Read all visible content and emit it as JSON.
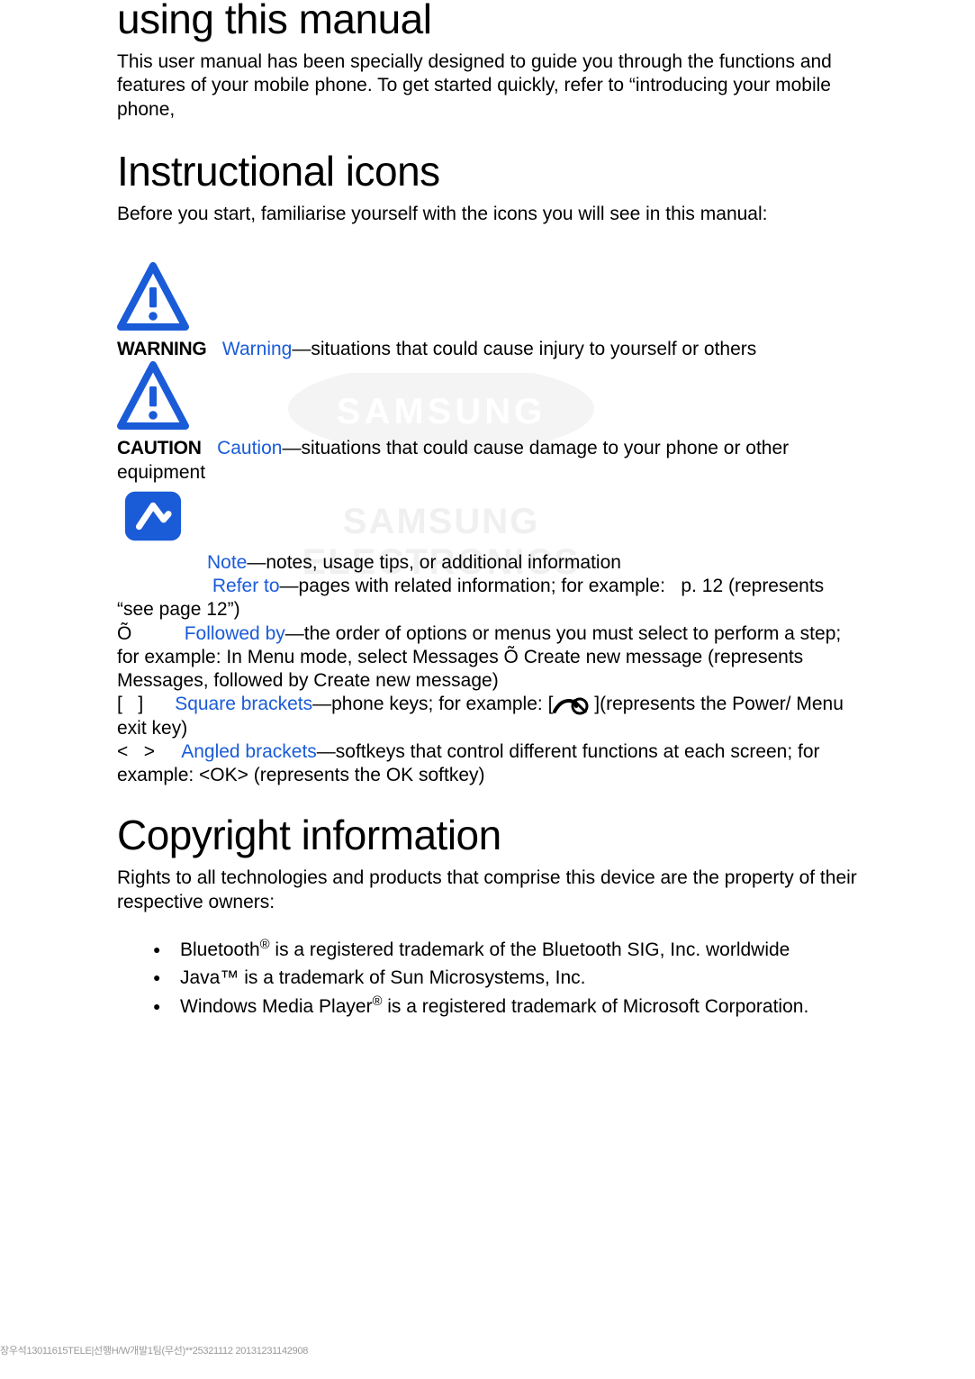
{
  "section1": {
    "title": "using this manual",
    "intro": "This user manual has been specially designed to guide you through the functions and features of your mobile phone. To get started quickly, refer to “introducing your mobile phone,"
  },
  "section2": {
    "title": "Instructional icons",
    "intro": "Before you start, familiarise yourself with the icons you will see in this manual:",
    "warning_label": "WARNING",
    "warning_term": "Warning",
    "warning_desc": "—situations that could cause injury to yourself or others",
    "caution_label": "CAUTION",
    "caution_term": "Caution",
    "caution_desc_1": "—situations that could cause damage to your phone or other equipment",
    "note_term": "Note",
    "note_desc": "—notes, usage tips, or additional information",
    "refer_term": "Refer to",
    "refer_desc_1": "—pages with related information; for example:   p. 12 (represents “see page 12”)",
    "followed_prefix": "Õ          ",
    "followed_term": "Followed by",
    "followed_desc": "—the order of options or menus you must select to perform a step; for example: In Menu mode, select Messages Õ Create new message (represents Messages, followed by Create new message)",
    "square_prefix": "[   ]      ",
    "square_term": "Square brackets",
    "square_desc_1": "—phone keys; for example: [",
    "square_desc_2": " ](represents the Power/ Menu exit key)",
    "angled_prefix": "<   >     ",
    "angled_term": "Angled brackets",
    "angled_desc": "—softkeys that control different functions at each screen; for example: <OK> (represents the OK softkey)"
  },
  "section3": {
    "title": "Copyright information",
    "intro": "Rights to all technologies and products that comprise this device are the property of their respective owners:",
    "items_html": [
      "Bluetooth<sup>®</sup> is a registered trademark of the Bluetooth SIG, Inc. worldwide",
      "Java™ is a trademark of Sun Microsystems, Inc.",
      "Windows Media Player<sup>®</sup> is a registered trademark of Microsoft Corporation."
    ]
  },
  "watermark": {
    "brand": "SAMSUNG",
    "line2": "SAMSUNG ELECTRONICS"
  },
  "footer": "장우석13011615TELE|선행H/W개발1팀(무선)**25321112 20131231142908"
}
